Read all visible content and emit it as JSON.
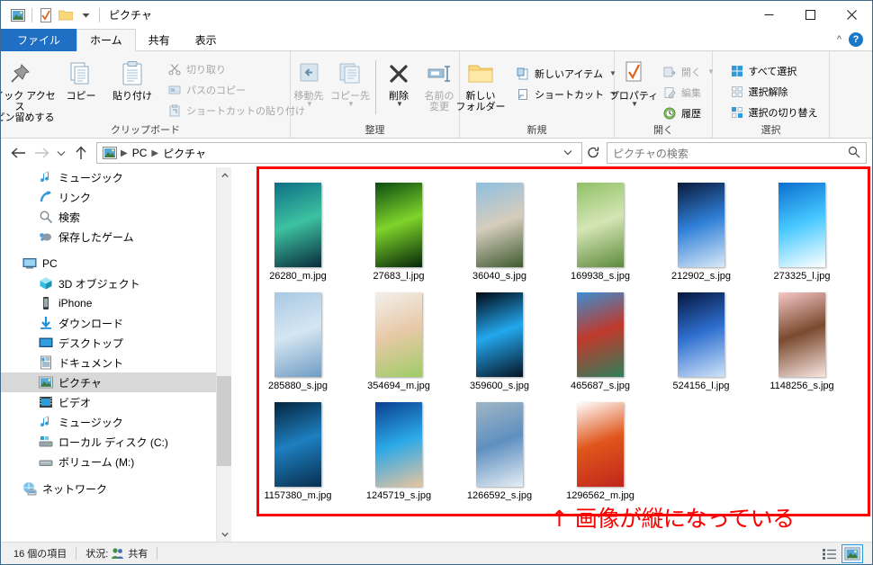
{
  "window": {
    "title": "ピクチャ",
    "quick_access_icons": [
      "picture-icon",
      "properties-icon",
      "new-folder-icon",
      "dropdown-caret-icon"
    ],
    "controls": {
      "minimize": "–",
      "maximize": "□",
      "close": "✕"
    }
  },
  "ribbon": {
    "tabs": [
      {
        "label": "ファイル",
        "type": "file"
      },
      {
        "label": "ホーム",
        "type": "active"
      },
      {
        "label": "共有",
        "type": "normal"
      },
      {
        "label": "表示",
        "type": "normal"
      }
    ],
    "collapse_icon": "chevron-up-icon",
    "help_icon": "help-icon",
    "help_label": "?",
    "groups": [
      {
        "name": "クリップボード",
        "big_buttons": [
          {
            "label": "クイック アクセス\nにピン留めする",
            "line1": "クイック アクセス",
            "line2": "にピン留めする",
            "icon": "pin-icon",
            "disabled": false
          },
          {
            "label": "コピー",
            "line1": "コピー",
            "line2": "",
            "icon": "copy-icon",
            "disabled": false
          },
          {
            "label": "貼り付け",
            "line1": "貼り付け",
            "line2": "",
            "icon": "paste-icon",
            "disabled": false
          }
        ],
        "small_buttons": [
          {
            "label": "切り取り",
            "icon": "scissors-icon",
            "disabled": true
          },
          {
            "label": "パスのコピー",
            "icon": "copy-path-icon",
            "disabled": true
          },
          {
            "label": "ショートカットの貼り付け",
            "icon": "paste-shortcut-icon",
            "disabled": true
          }
        ]
      },
      {
        "name": "整理",
        "big_buttons": [
          {
            "line1": "移動先",
            "line2": "",
            "icon": "move-to-icon",
            "disabled": true,
            "caret": true
          },
          {
            "line1": "コピー先",
            "line2": "",
            "icon": "copy-to-icon",
            "disabled": true,
            "caret": true
          },
          {
            "line1": "削除",
            "line2": "",
            "icon": "delete-icon",
            "disabled": false,
            "caret": true
          },
          {
            "line1": "名前の",
            "line2": "変更",
            "icon": "rename-icon",
            "disabled": true,
            "caret": false
          }
        ],
        "small_buttons": []
      },
      {
        "name": "新規",
        "big_buttons": [
          {
            "line1": "新しい",
            "line2": "フォルダー",
            "icon": "new-folder-icon",
            "disabled": false
          }
        ],
        "small_buttons": [
          {
            "label": "新しいアイテム",
            "icon": "new-item-icon",
            "disabled": false,
            "caret": true
          },
          {
            "label": "ショートカット",
            "icon": "shortcut-icon",
            "disabled": false,
            "caret": true
          }
        ]
      },
      {
        "name": "開く",
        "big_buttons": [
          {
            "line1": "プロパティ",
            "line2": "",
            "icon": "properties-icon",
            "disabled": false,
            "caret": true
          }
        ],
        "small_buttons": [
          {
            "label": "開く",
            "icon": "open-icon",
            "disabled": true,
            "caret": true
          },
          {
            "label": "編集",
            "icon": "edit-icon",
            "disabled": true
          },
          {
            "label": "履歴",
            "icon": "history-icon",
            "disabled": false
          }
        ]
      },
      {
        "name": "選択",
        "big_buttons": [],
        "small_buttons": [
          {
            "label": "すべて選択",
            "icon": "select-all-icon",
            "disabled": false
          },
          {
            "label": "選択解除",
            "icon": "select-none-icon",
            "disabled": false
          },
          {
            "label": "選択の切り替え",
            "icon": "invert-selection-icon",
            "disabled": false
          }
        ]
      }
    ]
  },
  "address": {
    "back_icon": "arrow-left-icon",
    "forward_icon": "arrow-right-icon",
    "recent_icon": "chevron-down-icon",
    "up_icon": "arrow-up-icon",
    "path_icon": "picture-icon",
    "breadcrumbs": [
      "PC",
      "ピクチャ"
    ],
    "dropdown_icon": "chevron-down-icon",
    "refresh_icon": "refresh-icon",
    "search_placeholder": "ピクチャの検索",
    "search_value": "",
    "search_icon": "search-icon"
  },
  "sidebar": {
    "items": [
      {
        "label": "ミュージック",
        "icon": "music-icon",
        "level": 2,
        "selected": false
      },
      {
        "label": "リンク",
        "icon": "links-icon",
        "level": 2,
        "selected": false
      },
      {
        "label": "検索",
        "icon": "search-folder-icon",
        "level": 2,
        "selected": false
      },
      {
        "label": "保存したゲーム",
        "icon": "saved-games-icon",
        "level": 2,
        "selected": false
      },
      {
        "label": "PC",
        "icon": "pc-icon",
        "level": 1,
        "selected": false,
        "gap_before": true
      },
      {
        "label": "3D オブジェクト",
        "icon": "3d-objects-icon",
        "level": 2,
        "selected": false
      },
      {
        "label": "iPhone",
        "icon": "iphone-icon",
        "level": 2,
        "selected": false
      },
      {
        "label": "ダウンロード",
        "icon": "downloads-icon",
        "level": 2,
        "selected": false
      },
      {
        "label": "デスクトップ",
        "icon": "desktop-icon",
        "level": 2,
        "selected": false
      },
      {
        "label": "ドキュメント",
        "icon": "documents-icon",
        "level": 2,
        "selected": false
      },
      {
        "label": "ピクチャ",
        "icon": "pictures-icon",
        "level": 2,
        "selected": true
      },
      {
        "label": "ビデオ",
        "icon": "videos-icon",
        "level": 2,
        "selected": false
      },
      {
        "label": "ミュージック",
        "icon": "music-icon",
        "level": 2,
        "selected": false
      },
      {
        "label": "ローカル ディスク (C:)",
        "icon": "local-disk-icon",
        "level": 2,
        "selected": false
      },
      {
        "label": "ボリューム (M:)",
        "icon": "volume-disk-icon",
        "level": 2,
        "selected": false
      },
      {
        "label": "ネットワーク",
        "icon": "network-icon",
        "level": 1,
        "selected": false,
        "gap_before": true
      }
    ],
    "scroll_up_icon": "chevron-up-icon",
    "scroll_down_icon": "chevron-down-icon"
  },
  "files": [
    {
      "name": "26280_m.jpg",
      "c1": "#0e6f86",
      "c2": "#3cc2a0",
      "c3": "#0a2b3c"
    },
    {
      "name": "27683_l.jpg",
      "c1": "#0d4c12",
      "c2": "#7fd42a",
      "c3": "#05270a"
    },
    {
      "name": "36040_s.jpg",
      "c1": "#8fbfe0",
      "c2": "#d6cdbd",
      "c3": "#3e5a30"
    },
    {
      "name": "169938_s.jpg",
      "c1": "#8fc166",
      "c2": "#d5e5b5",
      "c3": "#5d8a3c"
    },
    {
      "name": "212902_s.jpg",
      "c1": "#0a1a3a",
      "c2": "#2f7fd8",
      "c3": "#d9e9f7"
    },
    {
      "name": "273325_l.jpg",
      "c1": "#0b6fd0",
      "c2": "#46c8ff",
      "c3": "#ffffff"
    },
    {
      "name": "285880_s.jpg",
      "c1": "#a8c8e4",
      "c2": "#d5e6f2",
      "c3": "#6f9cc4"
    },
    {
      "name": "354694_m.jpg",
      "c1": "#f2f0ec",
      "c2": "#e8c9a8",
      "c3": "#9fcc66"
    },
    {
      "name": "359600_s.jpg",
      "c1": "#000814",
      "c2": "#23a8ee",
      "c3": "#061424"
    },
    {
      "name": "465687_s.jpg",
      "c1": "#3b8fd4",
      "c2": "#c0392b",
      "c3": "#2f7f5c"
    },
    {
      "name": "524156_l.jpg",
      "c1": "#05163f",
      "c2": "#2f6fd0",
      "c3": "#cfe3f8"
    },
    {
      "name": "1148256_s.jpg",
      "c1": "#f6c8c8",
      "c2": "#7a4a2e",
      "c3": "#f9e6e2"
    },
    {
      "name": "1157380_m.jpg",
      "c1": "#04253f",
      "c2": "#1e7fc0",
      "c3": "#072f4f"
    },
    {
      "name": "1245719_s.jpg",
      "c1": "#0a3f8f",
      "c2": "#2aa8e8",
      "c3": "#e8c4a0"
    },
    {
      "name": "1266592_s.jpg",
      "c1": "#9fb6c4",
      "c2": "#5f8fc0",
      "c3": "#e6eef5"
    },
    {
      "name": "1296562_m.jpg",
      "c1": "#ffffff",
      "c2": "#e0561b",
      "c3": "#c0261b"
    }
  ],
  "annotation": {
    "text": "↑ 画像が縦になっている",
    "color": "#fc0000"
  },
  "statusbar": {
    "item_count": "16 個の項目",
    "status_label": "状況:",
    "share_label": "共有",
    "share_icon": "people-icon",
    "view_details_icon": "details-view-icon",
    "view_thumbnails_icon": "large-icons-view-icon"
  }
}
